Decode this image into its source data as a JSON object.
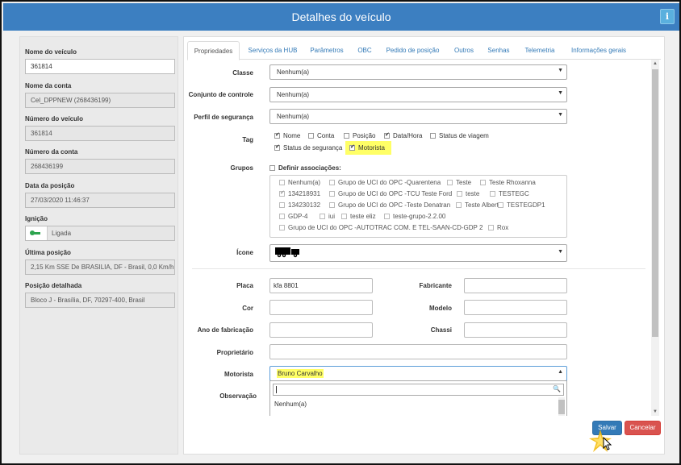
{
  "window": {
    "title": "Detalhes do veículo",
    "info_icon": "info-icon"
  },
  "left_panel": {
    "fields": [
      {
        "label": "Nome do veículo",
        "value": "361814"
      },
      {
        "label": "Nome da conta",
        "value": "Cel_DPPNEW (268436199)"
      },
      {
        "label": "Número do veículo",
        "value": "361814"
      },
      {
        "label": "Número da conta",
        "value": "268436199"
      },
      {
        "label": "Data da posição",
        "value": "27/03/2020 11:46:37"
      },
      {
        "label": "Ignição",
        "value": "Ligada",
        "icon": "ignition-key-icon"
      },
      {
        "label": "Última posição",
        "value": "2,15 Km SSE De BRASILIA, DF - Brasil, 0,0 Km/h"
      },
      {
        "label": "Posição detalhada",
        "value": "Bloco J - Brasília, DF, 70297-400, Brasil"
      }
    ]
  },
  "tabs": [
    "Propriedades",
    "Serviços da HUB",
    "Parâmetros",
    "OBC",
    "Pedido de posição",
    "Outros",
    "Senhas",
    "Telemetria",
    "Informações gerais"
  ],
  "form": {
    "classe": {
      "label": "Classe",
      "value": "Nenhum(a)"
    },
    "conjunto": {
      "label": "Conjunto de controle",
      "value": "Nenhum(a)"
    },
    "perfil": {
      "label": "Perfil de segurança",
      "value": "Nenhum(a)"
    },
    "tag": {
      "label": "Tag",
      "options": [
        {
          "label": "Nome",
          "checked": true
        },
        {
          "label": "Conta",
          "checked": false
        },
        {
          "label": "Posição",
          "checked": false
        },
        {
          "label": "Data/Hora",
          "checked": true
        },
        {
          "label": "Status de viagem",
          "checked": false
        },
        {
          "label": "Status de segurança",
          "checked": true
        },
        {
          "label": "Motorista",
          "checked": true
        }
      ]
    },
    "grupos": {
      "label": "Grupos",
      "define_label": "Definir associações:",
      "items": [
        {
          "label": "Nenhum(a)",
          "checked": false
        },
        {
          "label": "Grupo de UCI do OPC -Quarentena",
          "checked": false
        },
        {
          "label": "Teste",
          "checked": false
        },
        {
          "label": "Teste Rhoxanna",
          "checked": false
        },
        {
          "label": "134218931",
          "checked": true
        },
        {
          "label": "Grupo de UCI do OPC -TCU Teste Ford",
          "checked": false
        },
        {
          "label": "teste",
          "checked": false
        },
        {
          "label": "TESTEGC",
          "checked": false
        },
        {
          "label": "134230132",
          "checked": false
        },
        {
          "label": "Grupo de UCI do OPC -Teste Denatran",
          "checked": false
        },
        {
          "label": "Teste Albert",
          "checked": false
        },
        {
          "label": "TESTEGDP1",
          "checked": false
        },
        {
          "label": "GDP-4",
          "checked": false
        },
        {
          "label": "iui",
          "checked": false
        },
        {
          "label": "teste eliz",
          "checked": false
        },
        {
          "label": "teste-grupo-2.2.00",
          "checked": false
        },
        {
          "label": "Grupo de UCI do OPC -AUTOTRAC COM. E TEL-SAAN-CD-GDP 2",
          "checked": false
        },
        {
          "label": "Rox",
          "checked": false
        }
      ]
    },
    "icone": {
      "label": "Ícone",
      "icon": "truck-icon"
    },
    "placa": {
      "label": "Placa",
      "value": "kfa 8801"
    },
    "fabricante": {
      "label": "Fabricante",
      "value": ""
    },
    "cor": {
      "label": "Cor",
      "value": ""
    },
    "modelo": {
      "label": "Modelo",
      "value": ""
    },
    "ano": {
      "label": "Ano de fabricação",
      "value": ""
    },
    "chassi": {
      "label": "Chassi",
      "value": ""
    },
    "proprietario": {
      "label": "Proprietário",
      "value": ""
    },
    "motorista": {
      "label": "Motorista",
      "value": "Bruno Carvalho",
      "dropdown_first": "Nenhum(a)"
    },
    "observacao": {
      "label": "Observação"
    }
  },
  "buttons": {
    "save": "Salvar",
    "cancel": "Cancelar"
  },
  "colors": {
    "header": "#3c7fc1",
    "save": "#337ab7",
    "cancel": "#d9534f",
    "highlight": "#ffff66"
  }
}
